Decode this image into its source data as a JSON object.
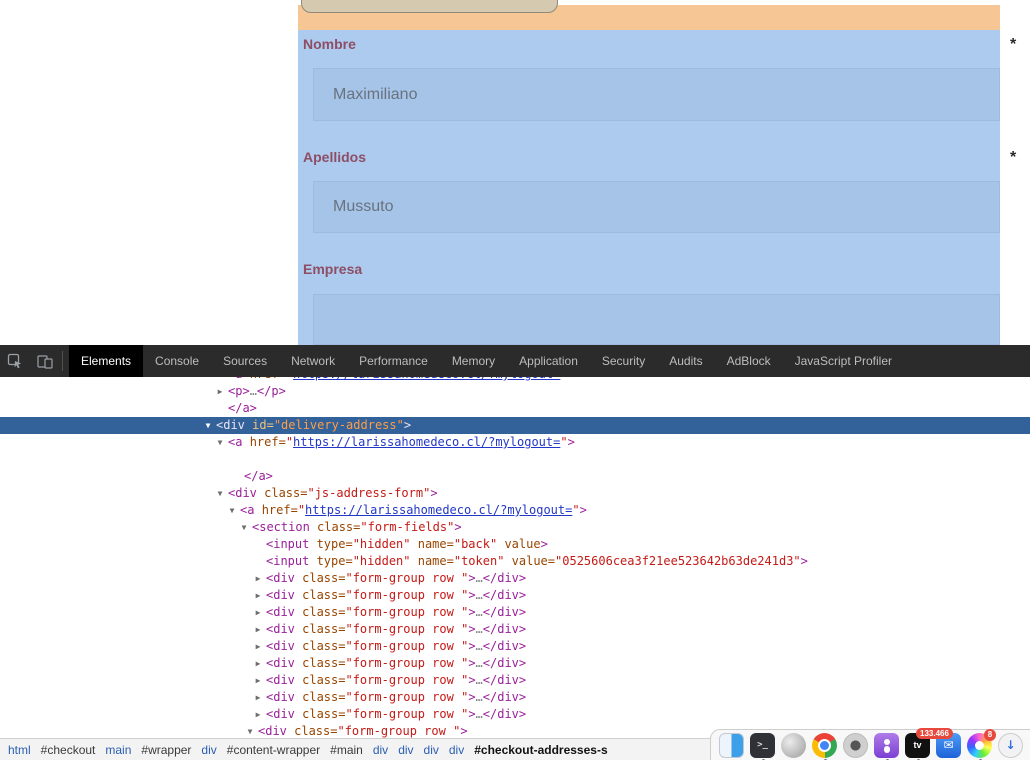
{
  "colors": {
    "hl-blue": "#adcbee",
    "hl-input": "#a6c3e8",
    "hl-orange": "#f6c795",
    "label": "#8d4e66",
    "value-text": "#68737f",
    "tabbar-bg": "#2b2b2b",
    "tab-active-bg": "#000000",
    "tab-active-fg": "#ffffff",
    "tab-fg": "#bdbdbd",
    "sel-row-bg": "#33619a",
    "syn-tag": "#9a1f9a",
    "syn-attr": "#994500",
    "syn-value": "#c41a16",
    "syn-link": "#2337c6",
    "crumb-tag": "#2a5db2",
    "crumb-id": "#3a3a3a",
    "badge-red": "#e8493d"
  },
  "page": {
    "fields": [
      {
        "label": "Nombre",
        "value": "Maximiliano",
        "required": "*"
      },
      {
        "label": "Apellidos",
        "value": "Mussuto",
        "required": "*"
      },
      {
        "label": "Empresa",
        "value": "",
        "required": ""
      }
    ]
  },
  "devtools": {
    "tabs": [
      {
        "label": "Elements",
        "active": true
      },
      {
        "label": "Console"
      },
      {
        "label": "Sources"
      },
      {
        "label": "Network"
      },
      {
        "label": "Performance"
      },
      {
        "label": "Memory"
      },
      {
        "label": "Application"
      },
      {
        "label": "Security"
      },
      {
        "label": "Audits"
      },
      {
        "label": "AdBlock"
      },
      {
        "label": "JavaScript Profiler"
      }
    ],
    "tree": [
      {
        "pad": 228,
        "seg": [
          {
            "c": "t",
            "x": "<a "
          },
          {
            "c": "a",
            "x": "href="
          },
          {
            "c": "v",
            "x": "\""
          },
          {
            "c": "l",
            "x": "https://larissahomedeco.cl/?mylogout="
          },
          {
            "c": "v",
            "x": "\""
          },
          {
            "c": "t",
            "x": ">"
          }
        ]
      },
      {
        "pad": 228,
        "arrow": "r",
        "seg": [
          {
            "c": "t",
            "x": "<p>"
          },
          {
            "c": "e",
            "x": "…"
          },
          {
            "c": "t",
            "x": "</p>"
          }
        ]
      },
      {
        "pad": 228,
        "seg": [
          {
            "c": "t",
            "x": "</a>"
          }
        ]
      },
      {
        "pad": 216,
        "arrow": "d",
        "sel": true,
        "seg": [
          {
            "c": "t",
            "x": "<div "
          },
          {
            "c": "a",
            "x": "id="
          },
          {
            "c": "v",
            "x": "\"delivery-address\""
          },
          {
            "c": "t",
            "x": ">"
          }
        ]
      },
      {
        "pad": 228,
        "arrow": "d",
        "seg": [
          {
            "c": "t",
            "x": "<a "
          },
          {
            "c": "a",
            "x": "href="
          },
          {
            "c": "v",
            "x": "\""
          },
          {
            "c": "l",
            "x": "https://larissahomedeco.cl/?mylogout="
          },
          {
            "c": "v",
            "x": "\""
          },
          {
            "c": "t",
            "x": ">"
          }
        ]
      },
      {
        "pad": 252,
        "seg": []
      },
      {
        "pad": 244,
        "seg": [
          {
            "c": "t",
            "x": "</a>"
          }
        ]
      },
      {
        "pad": 228,
        "arrow": "d",
        "seg": [
          {
            "c": "t",
            "x": "<div "
          },
          {
            "c": "a",
            "x": "class="
          },
          {
            "c": "v",
            "x": "\"js-address-form\""
          },
          {
            "c": "t",
            "x": ">"
          }
        ]
      },
      {
        "pad": 240,
        "arrow": "d",
        "seg": [
          {
            "c": "t",
            "x": "<a "
          },
          {
            "c": "a",
            "x": "href="
          },
          {
            "c": "v",
            "x": "\""
          },
          {
            "c": "l",
            "x": "https://larissahomedeco.cl/?mylogout="
          },
          {
            "c": "v",
            "x": "\""
          },
          {
            "c": "t",
            "x": ">"
          }
        ]
      },
      {
        "pad": 252,
        "arrow": "d",
        "seg": [
          {
            "c": "t",
            "x": "<section "
          },
          {
            "c": "a",
            "x": "class="
          },
          {
            "c": "v",
            "x": "\"form-fields\""
          },
          {
            "c": "t",
            "x": ">"
          }
        ]
      },
      {
        "pad": 266,
        "seg": [
          {
            "c": "t",
            "x": "<input "
          },
          {
            "c": "a",
            "x": "type="
          },
          {
            "c": "v",
            "x": "\"hidden\" "
          },
          {
            "c": "a",
            "x": "name="
          },
          {
            "c": "v",
            "x": "\"back\" "
          },
          {
            "c": "a",
            "x": "value"
          },
          {
            "c": "t",
            "x": ">"
          }
        ]
      },
      {
        "pad": 266,
        "seg": [
          {
            "c": "t",
            "x": "<input "
          },
          {
            "c": "a",
            "x": "type="
          },
          {
            "c": "v",
            "x": "\"hidden\" "
          },
          {
            "c": "a",
            "x": "name="
          },
          {
            "c": "v",
            "x": "\"token\" "
          },
          {
            "c": "a",
            "x": "value="
          },
          {
            "c": "v",
            "x": "\"0525606cea3f21ee523642b63de241d3\""
          },
          {
            "c": "t",
            "x": ">"
          }
        ]
      },
      {
        "pad": 266,
        "arrow": "r",
        "seg": [
          {
            "c": "t",
            "x": "<div "
          },
          {
            "c": "a",
            "x": "class="
          },
          {
            "c": "v",
            "x": "\"form-group row \""
          },
          {
            "c": "t",
            "x": ">"
          },
          {
            "c": "e",
            "x": "…"
          },
          {
            "c": "t",
            "x": "</div>"
          }
        ]
      },
      {
        "pad": 266,
        "arrow": "r",
        "seg": [
          {
            "c": "t",
            "x": "<div "
          },
          {
            "c": "a",
            "x": "class="
          },
          {
            "c": "v",
            "x": "\"form-group row \""
          },
          {
            "c": "t",
            "x": ">"
          },
          {
            "c": "e",
            "x": "…"
          },
          {
            "c": "t",
            "x": "</div>"
          }
        ]
      },
      {
        "pad": 266,
        "arrow": "r",
        "seg": [
          {
            "c": "t",
            "x": "<div "
          },
          {
            "c": "a",
            "x": "class="
          },
          {
            "c": "v",
            "x": "\"form-group row \""
          },
          {
            "c": "t",
            "x": ">"
          },
          {
            "c": "e",
            "x": "…"
          },
          {
            "c": "t",
            "x": "</div>"
          }
        ]
      },
      {
        "pad": 266,
        "arrow": "r",
        "seg": [
          {
            "c": "t",
            "x": "<div "
          },
          {
            "c": "a",
            "x": "class="
          },
          {
            "c": "v",
            "x": "\"form-group row \""
          },
          {
            "c": "t",
            "x": ">"
          },
          {
            "c": "e",
            "x": "…"
          },
          {
            "c": "t",
            "x": "</div>"
          }
        ]
      },
      {
        "pad": 266,
        "arrow": "r",
        "seg": [
          {
            "c": "t",
            "x": "<div "
          },
          {
            "c": "a",
            "x": "class="
          },
          {
            "c": "v",
            "x": "\"form-group row \""
          },
          {
            "c": "t",
            "x": ">"
          },
          {
            "c": "e",
            "x": "…"
          },
          {
            "c": "t",
            "x": "</div>"
          }
        ]
      },
      {
        "pad": 266,
        "arrow": "r",
        "seg": [
          {
            "c": "t",
            "x": "<div "
          },
          {
            "c": "a",
            "x": "class="
          },
          {
            "c": "v",
            "x": "\"form-group row \""
          },
          {
            "c": "t",
            "x": ">"
          },
          {
            "c": "e",
            "x": "…"
          },
          {
            "c": "t",
            "x": "</div>"
          }
        ]
      },
      {
        "pad": 266,
        "arrow": "r",
        "seg": [
          {
            "c": "t",
            "x": "<div "
          },
          {
            "c": "a",
            "x": "class="
          },
          {
            "c": "v",
            "x": "\"form-group row \""
          },
          {
            "c": "t",
            "x": ">"
          },
          {
            "c": "e",
            "x": "…"
          },
          {
            "c": "t",
            "x": "</div>"
          }
        ]
      },
      {
        "pad": 266,
        "arrow": "r",
        "seg": [
          {
            "c": "t",
            "x": "<div "
          },
          {
            "c": "a",
            "x": "class="
          },
          {
            "c": "v",
            "x": "\"form-group row \""
          },
          {
            "c": "t",
            "x": ">"
          },
          {
            "c": "e",
            "x": "…"
          },
          {
            "c": "t",
            "x": "</div>"
          }
        ]
      },
      {
        "pad": 266,
        "arrow": "r",
        "seg": [
          {
            "c": "t",
            "x": "<div "
          },
          {
            "c": "a",
            "x": "class="
          },
          {
            "c": "v",
            "x": "\"form-group row \""
          },
          {
            "c": "t",
            "x": ">"
          },
          {
            "c": "e",
            "x": "…"
          },
          {
            "c": "t",
            "x": "</div>"
          }
        ]
      },
      {
        "pad": 258,
        "arrow": "d",
        "seg": [
          {
            "c": "t",
            "x": "<div "
          },
          {
            "c": "a",
            "x": "class="
          },
          {
            "c": "v",
            "x": "\"form-group row \""
          },
          {
            "c": "t",
            "x": ">"
          }
        ]
      }
    ],
    "breadcrumbs": [
      {
        "x": "html",
        "c": "tag"
      },
      {
        "x": "#checkout",
        "c": "id"
      },
      {
        "x": "main",
        "c": "tag"
      },
      {
        "x": "#wrapper",
        "c": "id"
      },
      {
        "x": "div",
        "c": "tag"
      },
      {
        "x": "#content-wrapper",
        "c": "id"
      },
      {
        "x": "#main",
        "c": "id"
      },
      {
        "x": "div",
        "c": "tag"
      },
      {
        "x": "div",
        "c": "tag"
      },
      {
        "x": "div",
        "c": "tag"
      },
      {
        "x": "div",
        "c": "tag"
      },
      {
        "x": "#checkout-addresses-s",
        "c": "sel"
      }
    ]
  },
  "dock": {
    "icons": [
      {
        "name": "finder",
        "type": "finder"
      },
      {
        "name": "terminal",
        "type": "terminal",
        "glyph": ">_",
        "dot": true
      },
      {
        "name": "launchpad",
        "type": "gray"
      },
      {
        "name": "chrome",
        "type": "chrome",
        "dot": true
      },
      {
        "name": "camera",
        "type": "lens"
      },
      {
        "name": "podcasts",
        "type": "podcasts",
        "dot": true
      },
      {
        "name": "apple-tv",
        "type": "tv",
        "glyph": "tv",
        "dot": true
      },
      {
        "name": "mail",
        "type": "mail",
        "glyph": "✉",
        "badge": "133.466"
      },
      {
        "name": "photos",
        "type": "photos",
        "badge": "8",
        "dot": true
      },
      {
        "name": "downloads",
        "type": "download",
        "glyph": "↓"
      }
    ]
  }
}
